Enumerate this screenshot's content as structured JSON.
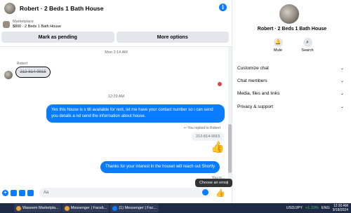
{
  "header": {
    "title": "Robert · 2 Beds 1 Bath House"
  },
  "marketplace": {
    "label": "Marketplace",
    "listing": "$800 · 2 Beds 1 Bath House"
  },
  "buttons": {
    "mark_pending": "Mark as pending",
    "more_options": "More options"
  },
  "messages": {
    "ts1": "Mon 3:14 AM",
    "sender": "Robert",
    "incoming_phone": "212-814-9915",
    "ts2": "12:29 AM",
    "out1": "Yes this house is s till available for rent, let me have your contact number so i can send you details a nd send the information about house.",
    "replied_label": "You replied to Robert",
    "quoted": "212-814-9915",
    "out2": "Thanks for your interest in the houset will reach out Shortly",
    "partial": "You re..."
  },
  "tooltip": "Choose an emoji",
  "composer": {
    "placeholder": "Aa"
  },
  "info_panel": {
    "name": "Robert · 2 Beds 1 Bath House",
    "mute": "Mute",
    "search": "Search",
    "menu": [
      "Customize chat",
      "Chat members",
      "Media, files and links",
      "Privacy & support"
    ]
  },
  "taskbar": {
    "items": [
      "Waseem Marketpla...",
      "Messenger | Faceb...",
      "(1) Messenger | Fac..."
    ],
    "ticker": "USD/JPY",
    "ticker_change": "+1.10%",
    "lang": "ENG",
    "time": "12:30 AM",
    "date": "9/18/2024"
  },
  "colors": {
    "accent": "#0a7cff",
    "taskbar": "#1f2a44"
  }
}
